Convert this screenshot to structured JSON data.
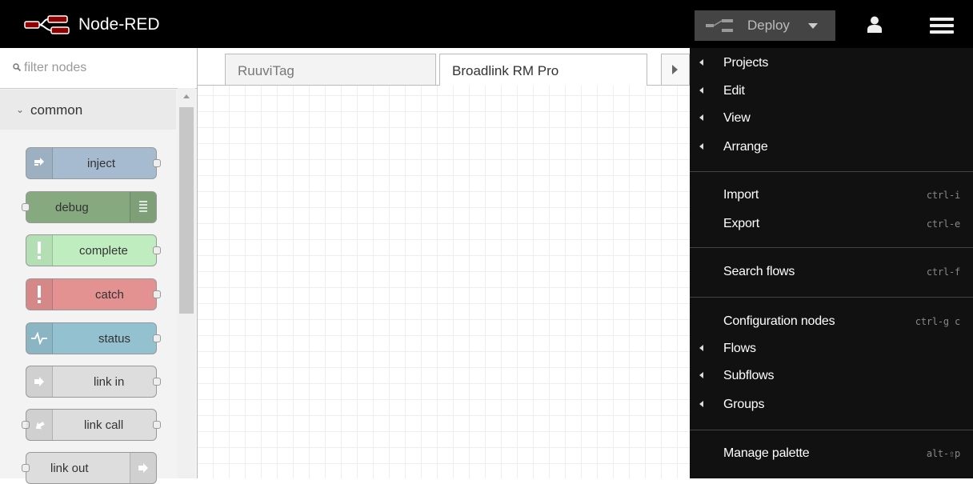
{
  "header": {
    "title": "Node-RED",
    "deploy_label": "Deploy",
    "icons": [
      "node-red-logo-icon",
      "deploy-icon",
      "caret-down-icon",
      "user-icon",
      "hamburger-menu-icon"
    ]
  },
  "palette": {
    "filter_placeholder": "filter nodes",
    "category": "common",
    "nodes": [
      {
        "label": "inject",
        "color": "#a6bbcf"
      },
      {
        "label": "debug",
        "color": "#87a980"
      },
      {
        "label": "complete",
        "color": "#c0edc0"
      },
      {
        "label": "catch",
        "color": "#e49191"
      },
      {
        "label": "status",
        "color": "#94c1d0"
      },
      {
        "label": "link in",
        "color": "#dddddd"
      },
      {
        "label": "link call",
        "color": "#dddddd"
      },
      {
        "label": "link out",
        "color": "#dddddd"
      }
    ]
  },
  "tabs": [
    {
      "label": "RuuviTag"
    },
    {
      "label": "Broadlink RM Pro"
    }
  ],
  "menu": {
    "items": {
      "projects": {
        "label": "Projects"
      },
      "edit": {
        "label": "Edit"
      },
      "view": {
        "label": "View"
      },
      "arrange": {
        "label": "Arrange"
      },
      "import": {
        "label": "Import",
        "shortcut": "ctrl-i"
      },
      "export": {
        "label": "Export",
        "shortcut": "ctrl-e"
      },
      "search": {
        "label": "Search flows",
        "shortcut": "ctrl-f"
      },
      "config": {
        "label": "Configuration nodes",
        "shortcut": "ctrl-g c"
      },
      "flows": {
        "label": "Flows"
      },
      "subflows": {
        "label": "Subflows"
      },
      "groups": {
        "label": "Groups"
      },
      "palette": {
        "label": "Manage palette",
        "shortcut": "alt-⇧p"
      }
    }
  }
}
